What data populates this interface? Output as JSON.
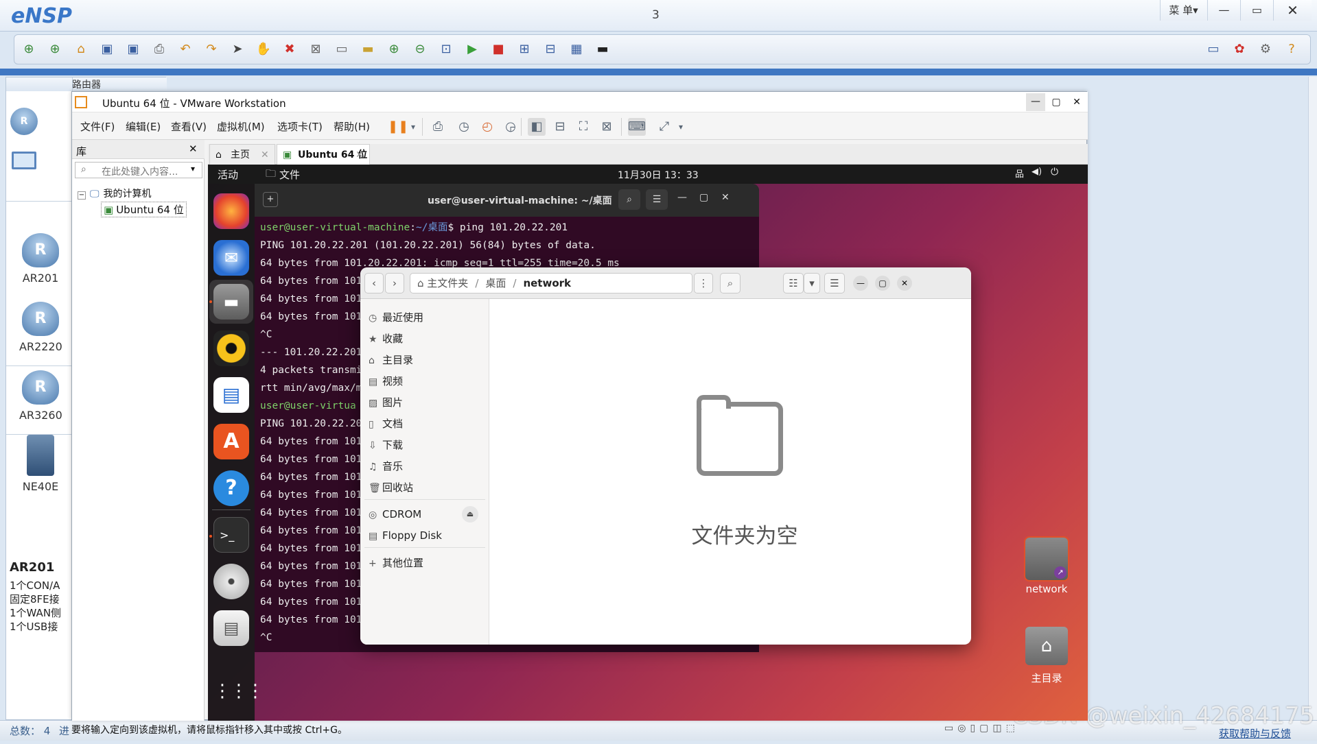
{
  "ensp": {
    "logo": "eNSP",
    "window_number": "3",
    "menu_label": "菜 单▾",
    "toolbar_icons": [
      "new-topology-icon",
      "new-lab-icon",
      "open-icon",
      "save-icon",
      "save-as-icon",
      "print-icon",
      "undo-icon",
      "redo-icon",
      "select-icon",
      "hand-icon",
      "delete-icon",
      "delete-all-icon",
      "text-icon",
      "rectangle-icon",
      "zoom-in-icon",
      "zoom-out-icon",
      "fit-icon",
      "start-icon",
      "stop-icon",
      "capture-icon",
      "topology-icon",
      "grid-icon",
      "terminal-icon"
    ],
    "panel_title": "路由器",
    "devices": [
      "AR201",
      "AR2220",
      "AR3260",
      "NE40E"
    ],
    "desc_title": "AR201",
    "desc_lines": [
      "1个CON/A",
      "固定8FE接",
      "1个WAN侧",
      "1个USB接"
    ],
    "status_count": "总数： 4",
    "status_more": "进",
    "status_help": "获取帮助与反馈",
    "watermark": "CSDN @weixin_42684175"
  },
  "vmware": {
    "title": "Ubuntu 64 位 - VMware Workstation",
    "menu": [
      "文件(F)",
      "编辑(E)",
      "查看(V)",
      "虚拟机(M)",
      "选项卡(T)",
      "帮助(H)"
    ],
    "library_title": "库",
    "library_search_placeholder": "在此处键入内容...",
    "tree_root": "我的计算机",
    "tree_child": "Ubuntu 64 位",
    "tabs": [
      "主页",
      "Ubuntu 64 位"
    ],
    "status_text": "要将输入定向到该虚拟机，请将鼠标指针移入其中或按 Ctrl+G。"
  },
  "ubuntu": {
    "activities": "活动",
    "app_name": "文件",
    "clock": "11月30日 13：33",
    "terminal_title": "user@user-virtual-machine: ~/桌面",
    "terminal_lines": [
      {
        "prompt": "user@user-virtual-machine",
        "path": "~/桌面",
        "cmd": "$ ping 101.20.22.201"
      },
      {
        "text": "PING 101.20.22.201 (101.20.22.201) 56(84) bytes of data."
      },
      {
        "text": "64 bytes from 101.20.22.201: icmp_seq=1 ttl=255 time=20.5 ms"
      },
      {
        "text": "64 bytes from 101"
      },
      {
        "text": "64 bytes from 101"
      },
      {
        "text": "64 bytes from 101"
      },
      {
        "text": "^C"
      },
      {
        "text": "--- 101.20.22.201"
      },
      {
        "text": "4 packets transmi"
      },
      {
        "text": "rtt min/avg/max/m"
      },
      {
        "prompt": "user@user-virtua",
        "path": "",
        "cmd": ""
      },
      {
        "text": "PING 101.20.22.20"
      },
      {
        "text": "64 bytes from 101"
      },
      {
        "text": "64 bytes from 101"
      },
      {
        "text": "64 bytes from 101"
      },
      {
        "text": "64 bytes from 101"
      },
      {
        "text": "64 bytes from 101"
      },
      {
        "text": "64 bytes from 101"
      },
      {
        "text": "64 bytes from 101"
      },
      {
        "text": "64 bytes from 101"
      },
      {
        "text": "64 bytes from 101"
      },
      {
        "text": "64 bytes from 101"
      },
      {
        "text": "64 bytes from 101"
      },
      {
        "text": "^C"
      }
    ],
    "file_manager": {
      "breadcrumb": [
        "主文件夹",
        "桌面",
        "network"
      ],
      "sidebar": [
        {
          "icon": "clock-icon",
          "glyph": "◷",
          "label": "最近使用"
        },
        {
          "icon": "star-icon",
          "glyph": "★",
          "label": "收藏"
        },
        {
          "icon": "home-icon",
          "glyph": "⌂",
          "label": "主目录"
        },
        {
          "icon": "video-icon",
          "glyph": "▤",
          "label": "视频"
        },
        {
          "icon": "picture-icon",
          "glyph": "▨",
          "label": "图片"
        },
        {
          "icon": "document-icon",
          "glyph": "▯",
          "label": "文档"
        },
        {
          "icon": "download-icon",
          "glyph": "⇩",
          "label": "下载"
        },
        {
          "icon": "music-icon",
          "glyph": "♫",
          "label": "音乐"
        },
        {
          "icon": "trash-icon",
          "glyph": "🗑",
          "label": "回收站"
        }
      ],
      "devices": [
        {
          "label": "CDROM"
        },
        {
          "label": "Floppy Disk"
        }
      ],
      "other_places": "其他位置",
      "empty_text": "文件夹为空"
    },
    "desktop_icons": [
      "network",
      "主目录"
    ]
  }
}
